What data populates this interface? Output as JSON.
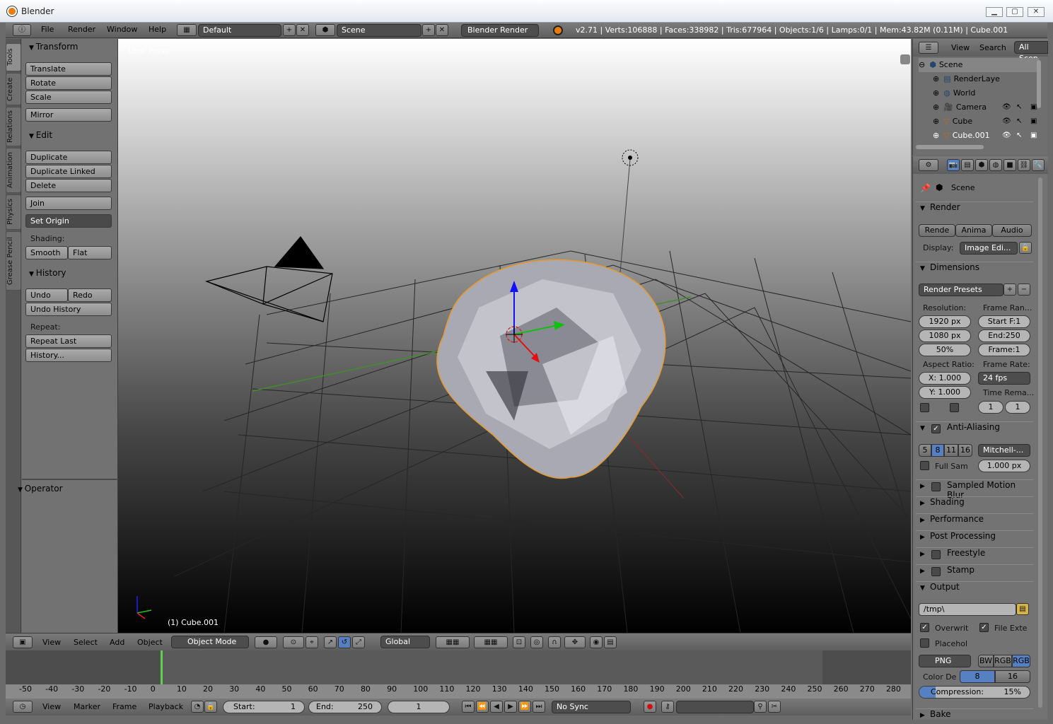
{
  "window": {
    "title": "Blender",
    "min": "▁",
    "max": "▢",
    "close": "✕"
  },
  "topbar": {
    "menus": [
      "File",
      "Render",
      "Window",
      "Help"
    ],
    "layout": "Default",
    "scene": "Scene",
    "engine": "Blender Render",
    "info": "v2.71 | Verts:106888 | Faces:338982 | Tris:677964 | Objects:1/6 | Lamps:0/1 | Mem:43.82M (0.11M) | Cube.001"
  },
  "lefttabs": [
    "Tools",
    "Create",
    "Relations",
    "Animation",
    "Physics",
    "Grease Pencil"
  ],
  "toolshelf": {
    "transform": "Transform",
    "translate": "Translate",
    "rotate": "Rotate",
    "scale": "Scale",
    "mirror": "Mirror",
    "edit": "Edit",
    "duplicate": "Duplicate",
    "duplicate_linked": "Duplicate Linked",
    "delete": "Delete",
    "join": "Join",
    "set_origin": "Set Origin",
    "shading": "Shading:",
    "smooth": "Smooth",
    "flat": "Flat",
    "history": "History",
    "undo": "Undo",
    "redo": "Redo",
    "undo_history": "Undo History",
    "repeat": "Repeat:",
    "repeat_last": "Repeat Last",
    "history_btn": "History...",
    "operator": "Operator"
  },
  "viewport": {
    "view_label": "User Persp",
    "object_label": "(1) Cube.001"
  },
  "vpheader": {
    "menus": [
      "View",
      "Select",
      "Add",
      "Object"
    ],
    "mode": "Object Mode",
    "orientation": "Global"
  },
  "timeline": {
    "ticks": [
      "-50",
      "-40",
      "-30",
      "-20",
      "-10",
      "0",
      "10",
      "20",
      "30",
      "40",
      "50",
      "60",
      "70",
      "80",
      "90",
      "100",
      "110",
      "120",
      "130",
      "140",
      "150",
      "160",
      "170",
      "180",
      "190",
      "200",
      "210",
      "220",
      "230",
      "240",
      "250",
      "260",
      "270",
      "280"
    ]
  },
  "tlheader": {
    "menus": [
      "View",
      "Marker",
      "Frame",
      "Playback"
    ],
    "start_label": "Start:",
    "start": "1",
    "end_label": "End:",
    "end": "250",
    "frame": "1",
    "sync": "No Sync"
  },
  "outliner": {
    "menus": [
      "View",
      "Search",
      "All Scen"
    ],
    "items": [
      {
        "label": "Scene",
        "indent": 0
      },
      {
        "label": "RenderLaye",
        "indent": 1
      },
      {
        "label": "World",
        "indent": 1
      },
      {
        "label": "Camera",
        "indent": 1
      },
      {
        "label": "Cube",
        "indent": 1
      },
      {
        "label": "Cube.001",
        "indent": 1
      }
    ]
  },
  "props": {
    "context": "Scene",
    "render": "Render",
    "render_btn": "Rende",
    "anim_btn": "Anima",
    "audio_btn": "Audio",
    "display_label": "Display:",
    "display": "Image Edi...",
    "dimensions": "Dimensions",
    "presets": "Render Presets",
    "resolution": "Resolution:",
    "frame_range": "Frame Ran...",
    "res_x": "1920 px",
    "res_y": "1080 px",
    "res_pct": "50%",
    "start_f": "Start F:1",
    "end_f": "End:250",
    "frame_f": "Frame:1",
    "aspect": "Aspect Ratio:",
    "frame_rate": "Frame Rate:",
    "asp_x": "X: 1.000",
    "asp_y": "Y: 1.000",
    "fps": "24 fps",
    "time_rema": "Time Rema...",
    "tr_a": "1",
    "tr_b": "1",
    "aa": "Anti-Aliasing",
    "aa_vals": [
      "5",
      "8",
      "11",
      "16"
    ],
    "filter": "Mitchell-...",
    "full_sam": "Full Sam",
    "filter_size": "1.000 px",
    "smb": "Sampled Motion Blur",
    "shading": "Shading",
    "performance": "Performance",
    "post": "Post Processing",
    "freestyle": "Freestyle",
    "stamp": "Stamp",
    "output": "Output",
    "path": "/tmp\\",
    "overwrite": "Overwrit",
    "file_ext": "File Exte",
    "placeholders": "Placehol",
    "format": "PNG",
    "bw": "BW",
    "rgb": "RGB",
    "rgba": "RGB",
    "color_depth": "Color De",
    "cd8": "8",
    "cd16": "16",
    "compression": "Compression:",
    "comp_val": "15%",
    "bake": "Bake"
  }
}
